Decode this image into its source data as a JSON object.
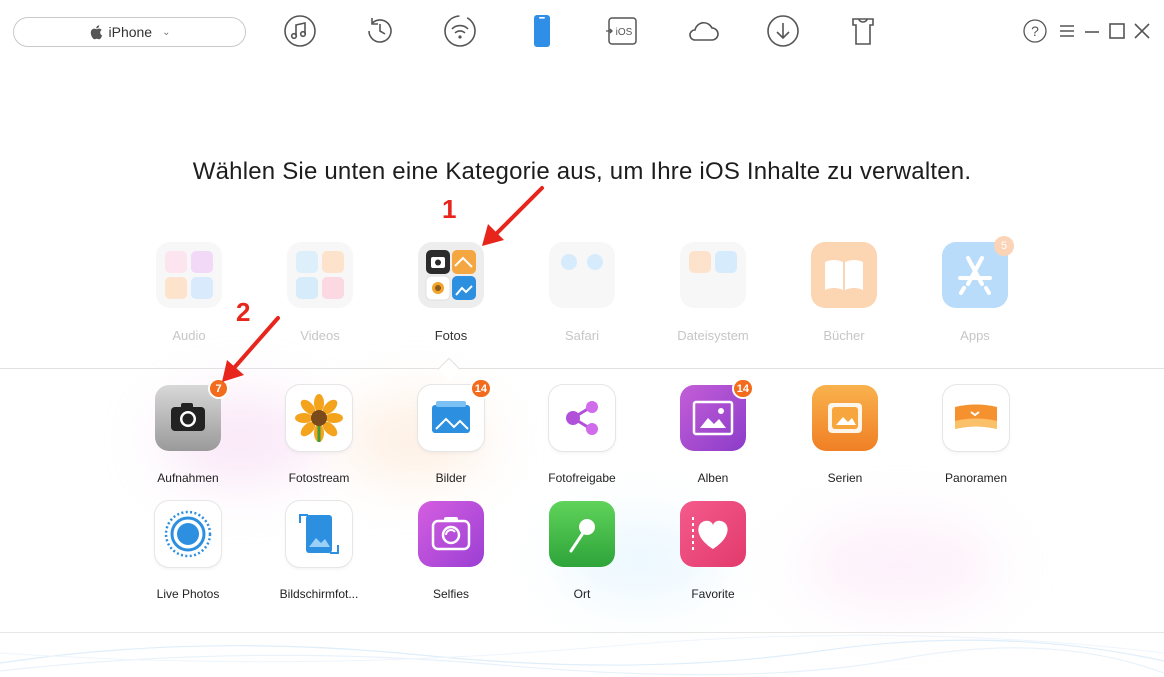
{
  "device": {
    "name": "iPhone"
  },
  "toolbar": [
    {
      "name": "music-icon"
    },
    {
      "name": "history-icon"
    },
    {
      "name": "wifi-sync-icon"
    },
    {
      "name": "device-icon"
    },
    {
      "name": "ios-transfer-icon"
    },
    {
      "name": "icloud-icon"
    },
    {
      "name": "download-icon"
    },
    {
      "name": "tshirt-icon"
    }
  ],
  "window": {
    "help": "?",
    "menu": "menu-icon",
    "minimize": "minimize-icon",
    "maximize": "maximize-icon",
    "close": "close-icon"
  },
  "headline": "Wählen Sie unten eine Kategorie aus, um Ihre iOS Inhalte zu verwalten.",
  "categories": [
    {
      "label": "Audio"
    },
    {
      "label": "Videos"
    },
    {
      "label": "Fotos",
      "active": true
    },
    {
      "label": "Safari"
    },
    {
      "label": "Dateisystem"
    },
    {
      "label": "Bücher"
    },
    {
      "label": "Apps",
      "badge": "5"
    }
  ],
  "photo_items": [
    {
      "label": "Aufnahmen",
      "badge": "7"
    },
    {
      "label": "Fotostream"
    },
    {
      "label": "Bilder",
      "badge": "14"
    },
    {
      "label": "Fotofreigabe"
    },
    {
      "label": "Alben",
      "badge": "14"
    },
    {
      "label": "Serien"
    },
    {
      "label": "Panoramen"
    },
    {
      "label": "Live Photos"
    },
    {
      "label": "Bildschirmfot..."
    },
    {
      "label": "Selfies"
    },
    {
      "label": "Ort"
    },
    {
      "label": "Favorite"
    }
  ],
  "annotations": {
    "one": "1",
    "two": "2"
  },
  "colors": {
    "accent": "#2f8ee6",
    "badge": "#f36b1c",
    "annotation": "#e8251c"
  }
}
